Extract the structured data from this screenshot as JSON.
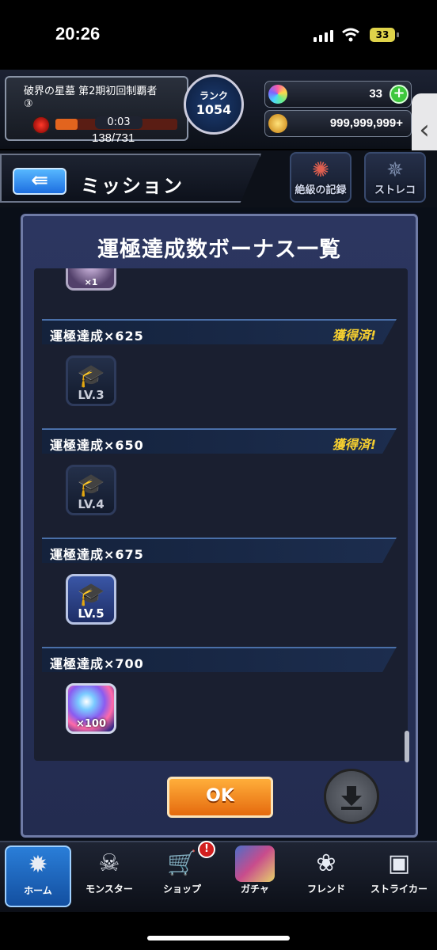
{
  "status_bar": {
    "time": "20:26",
    "battery": "33"
  },
  "header": {
    "player_title": "破界の星墓 第2期初回制覇者",
    "player_number": "③",
    "timer": "0:03",
    "stamina": "138/731",
    "rank_label": "ランク",
    "rank_value": "1054",
    "orbs": "33",
    "gold": "999,999,999+"
  },
  "nav": {
    "back_arrow": "⇚",
    "title": "ミッション",
    "zekkyo_label": "絶級の記録",
    "sutoreko_label": "ストレコ"
  },
  "modal": {
    "title": "運極達成数ボーナス一覧",
    "partial_item_qty": "×1",
    "entries": [
      {
        "label": "運極達成×625",
        "status": "獲得済!",
        "reward": "LV.3"
      },
      {
        "label": "運極達成×650",
        "status": "獲得済!",
        "reward": "LV.4"
      },
      {
        "label": "運極達成×675",
        "status": "",
        "reward": "LV.5"
      },
      {
        "label": "運極達成×700",
        "status": "",
        "reward": "×100"
      }
    ],
    "ok_label": "OK"
  },
  "tabs": [
    {
      "label": "ホーム"
    },
    {
      "label": "モンスター"
    },
    {
      "label": "ショップ"
    },
    {
      "label": "ガチャ"
    },
    {
      "label": "フレンド"
    },
    {
      "label": "ストライカー"
    }
  ],
  "shop_badge": "!"
}
